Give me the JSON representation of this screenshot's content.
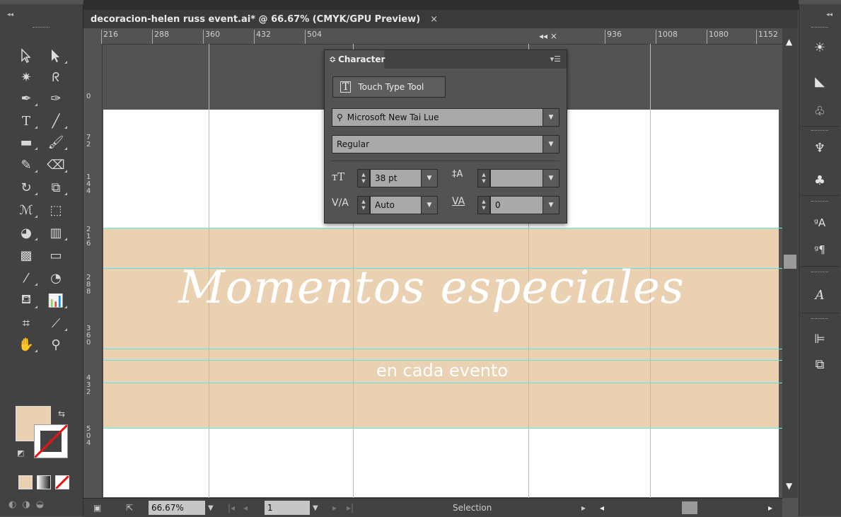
{
  "document": {
    "tab_title": "decoracion-helen russ event.ai* @ 66.67% (CMYK/GPU Preview)",
    "tab_close": "×"
  },
  "toolbar": {
    "collapse_label": "◂◂"
  },
  "ruler": {
    "top_ticks": [
      "216",
      "288",
      "360",
      "432",
      "504",
      "936",
      "1008",
      "1080",
      "1152"
    ],
    "left_ticks": [
      "0",
      "72",
      "144",
      "216",
      "288",
      "360",
      "432",
      "504"
    ]
  },
  "artwork": {
    "title": "Momentos especiales",
    "subtitle": "en cada evento"
  },
  "character_panel": {
    "tab_label": "Character",
    "panel_controls": "◂◂ ×",
    "touch_type_label": "Touch Type Tool",
    "font_family": "Microsoft New Tai Lue",
    "font_style": "Regular",
    "font_size": "38 pt",
    "leading": "",
    "kerning": "Auto",
    "tracking": "0"
  },
  "status_bar": {
    "zoom": "66.67%",
    "page": "1",
    "tool": "Selection"
  },
  "colors": {
    "fill": "#e9d1b2",
    "guide": "#5be3ea",
    "band": "#e9d1b2"
  }
}
